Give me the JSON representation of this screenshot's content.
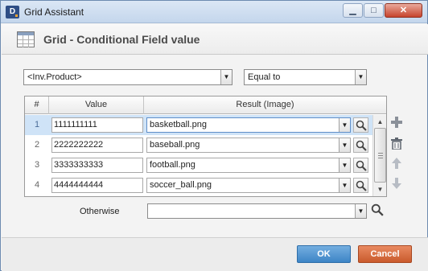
{
  "window": {
    "title": "Grid Assistant",
    "app_icon_letter": "D"
  },
  "header": {
    "title": "Grid - Conditional Field value"
  },
  "condition": {
    "field": "<Inv.Product>",
    "operator": "Equal to"
  },
  "table": {
    "columns": [
      "#",
      "Value",
      "Result (Image)"
    ],
    "rows": [
      {
        "num": "1",
        "value": "1111111111",
        "result": "basketball.png",
        "selected": true
      },
      {
        "num": "2",
        "value": "2222222222",
        "result": "baseball.png",
        "selected": false
      },
      {
        "num": "3",
        "value": "3333333333",
        "result": "football.png",
        "selected": false
      },
      {
        "num": "4",
        "value": "4444444444",
        "result": "soccer_ball.png",
        "selected": false
      }
    ]
  },
  "otherwise": {
    "label": "Otherwise",
    "value": ""
  },
  "buttons": {
    "ok": "OK",
    "cancel": "Cancel"
  },
  "colors": {
    "selected_row": "#cfe3f7",
    "ok": "#3d85c6",
    "cancel": "#c95a2c"
  }
}
